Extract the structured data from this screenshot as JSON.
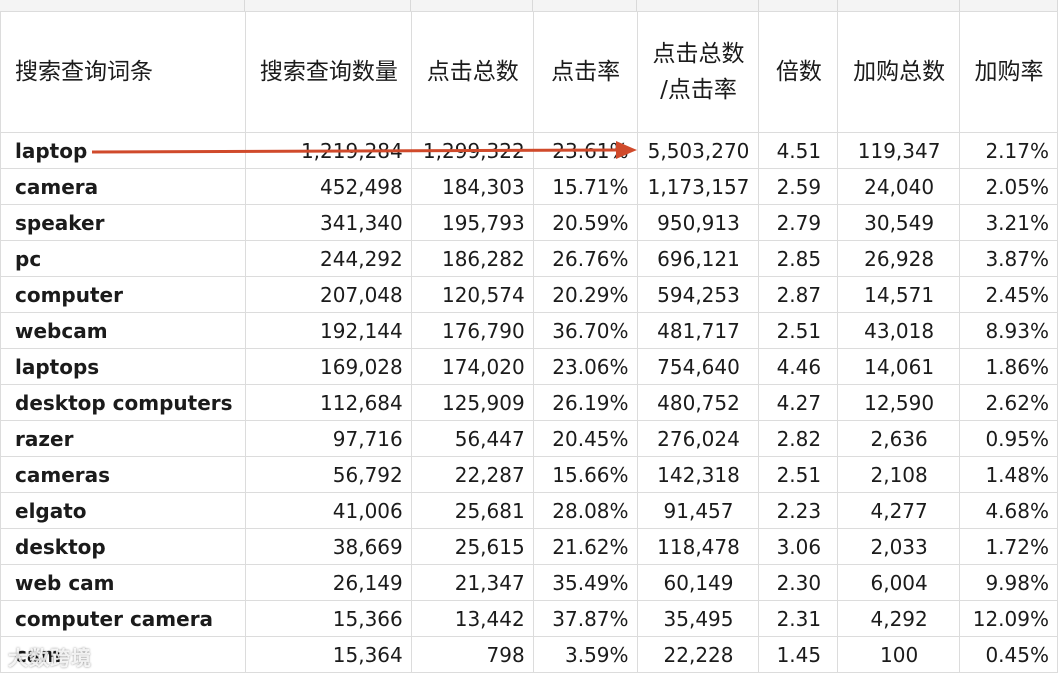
{
  "header": {
    "keyword": "搜索查询词条",
    "search_volume": "搜索查询数量",
    "clicks": "点击总数",
    "ctr": "点击率",
    "clicks_over_ctr_line1": "点击总数",
    "clicks_over_ctr_line2": "/点击率",
    "multiple": "倍数",
    "add_to_cart": "加购总数",
    "cart_rate": "加购率"
  },
  "rows": [
    {
      "keyword": "laptop",
      "search_volume": "1,219,284",
      "clicks": "1,299,322",
      "ctr": "23.61%",
      "ratio": "5,503,270",
      "multiple": "4.51",
      "add_to_cart": "119,347",
      "cart_rate": "2.17%"
    },
    {
      "keyword": "camera",
      "search_volume": "452,498",
      "clicks": "184,303",
      "ctr": "15.71%",
      "ratio": "1,173,157",
      "multiple": "2.59",
      "add_to_cart": "24,040",
      "cart_rate": "2.05%"
    },
    {
      "keyword": "speaker",
      "search_volume": "341,340",
      "clicks": "195,793",
      "ctr": "20.59%",
      "ratio": "950,913",
      "multiple": "2.79",
      "add_to_cart": "30,549",
      "cart_rate": "3.21%"
    },
    {
      "keyword": "pc",
      "search_volume": "244,292",
      "clicks": "186,282",
      "ctr": "26.76%",
      "ratio": "696,121",
      "multiple": "2.85",
      "add_to_cart": "26,928",
      "cart_rate": "3.87%"
    },
    {
      "keyword": "computer",
      "search_volume": "207,048",
      "clicks": "120,574",
      "ctr": "20.29%",
      "ratio": "594,253",
      "multiple": "2.87",
      "add_to_cart": "14,571",
      "cart_rate": "2.45%"
    },
    {
      "keyword": "webcam",
      "search_volume": "192,144",
      "clicks": "176,790",
      "ctr": "36.70%",
      "ratio": "481,717",
      "multiple": "2.51",
      "add_to_cart": "43,018",
      "cart_rate": "8.93%"
    },
    {
      "keyword": "laptops",
      "search_volume": "169,028",
      "clicks": "174,020",
      "ctr": "23.06%",
      "ratio": "754,640",
      "multiple": "4.46",
      "add_to_cart": "14,061",
      "cart_rate": "1.86%"
    },
    {
      "keyword": "desktop computers",
      "search_volume": "112,684",
      "clicks": "125,909",
      "ctr": "26.19%",
      "ratio": "480,752",
      "multiple": "4.27",
      "add_to_cart": "12,590",
      "cart_rate": "2.62%"
    },
    {
      "keyword": "razer",
      "search_volume": "97,716",
      "clicks": "56,447",
      "ctr": "20.45%",
      "ratio": "276,024",
      "multiple": "2.82",
      "add_to_cart": "2,636",
      "cart_rate": "0.95%"
    },
    {
      "keyword": "cameras",
      "search_volume": "56,792",
      "clicks": "22,287",
      "ctr": "15.66%",
      "ratio": "142,318",
      "multiple": "2.51",
      "add_to_cart": "2,108",
      "cart_rate": "1.48%"
    },
    {
      "keyword": "elgato",
      "search_volume": "41,006",
      "clicks": "25,681",
      "ctr": "28.08%",
      "ratio": "91,457",
      "multiple": "2.23",
      "add_to_cart": "4,277",
      "cart_rate": "4.68%"
    },
    {
      "keyword": "desktop",
      "search_volume": "38,669",
      "clicks": "25,615",
      "ctr": "21.62%",
      "ratio": "118,478",
      "multiple": "3.06",
      "add_to_cart": "2,033",
      "cart_rate": "1.72%"
    },
    {
      "keyword": "web cam",
      "search_volume": "26,149",
      "clicks": "21,347",
      "ctr": "35.49%",
      "ratio": "60,149",
      "multiple": "2.30",
      "add_to_cart": "6,004",
      "cart_rate": "9.98%"
    },
    {
      "keyword": "computer camera",
      "search_volume": "15,366",
      "clicks": "13,442",
      "ctr": "37.87%",
      "ratio": "35,495",
      "multiple": "2.31",
      "add_to_cart": "4,292",
      "cart_rate": "12.09%"
    },
    {
      "keyword": "cam",
      "search_volume": "15,364",
      "clicks": "798",
      "ctr": "3.59%",
      "ratio": "22,228",
      "multiple": "1.45",
      "add_to_cart": "100",
      "cart_rate": "0.45%"
    }
  ],
  "annotation": {
    "arrow_color": "#d04a2b"
  },
  "watermark": "大数跨境"
}
